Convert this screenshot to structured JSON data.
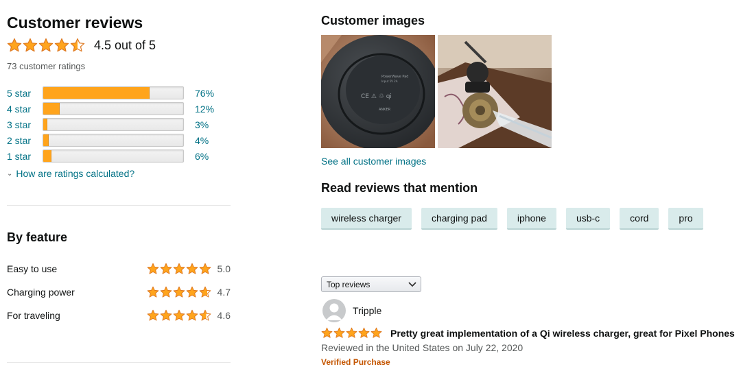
{
  "reviews_summary": {
    "title": "Customer reviews",
    "overall_text": "4.5 out of 5",
    "overall_rating": 4.5,
    "total_ratings": "73 customer ratings",
    "histogram": [
      {
        "label": "5 star",
        "percent_text": "76%",
        "percent": 76
      },
      {
        "label": "4 star",
        "percent_text": "12%",
        "percent": 12
      },
      {
        "label": "3 star",
        "percent_text": "3%",
        "percent": 3
      },
      {
        "label": "2 star",
        "percent_text": "4%",
        "percent": 4
      },
      {
        "label": "1 star",
        "percent_text": "6%",
        "percent": 6
      }
    ],
    "calc_link": "How are ratings calculated?"
  },
  "by_feature": {
    "title": "By feature",
    "items": [
      {
        "name": "Easy to use",
        "score": "5.0",
        "rating": 5.0
      },
      {
        "name": "Charging power",
        "score": "4.7",
        "rating": 4.7
      },
      {
        "name": "For traveling",
        "score": "4.6",
        "rating": 4.6
      }
    ]
  },
  "customer_images": {
    "title": "Customer images",
    "see_all": "See all customer images"
  },
  "mentions": {
    "title": "Read reviews that mention",
    "chips": [
      "wireless charger",
      "charging pad",
      "iphone",
      "usb-c",
      "cord",
      "pro"
    ]
  },
  "sort": {
    "selected": "Top reviews"
  },
  "review": {
    "reviewer": "Tripple",
    "rating": 5,
    "title": "Pretty great implementation of a Qi wireless charger, great for Pixel Phones",
    "meta": "Reviewed in the United States on July 22, 2020",
    "badge": "Verified Purchase"
  },
  "colors": {
    "star": "#ffa41c",
    "link": "#007185",
    "chip_bg": "#d9ebeb",
    "verified": "#c45500"
  }
}
